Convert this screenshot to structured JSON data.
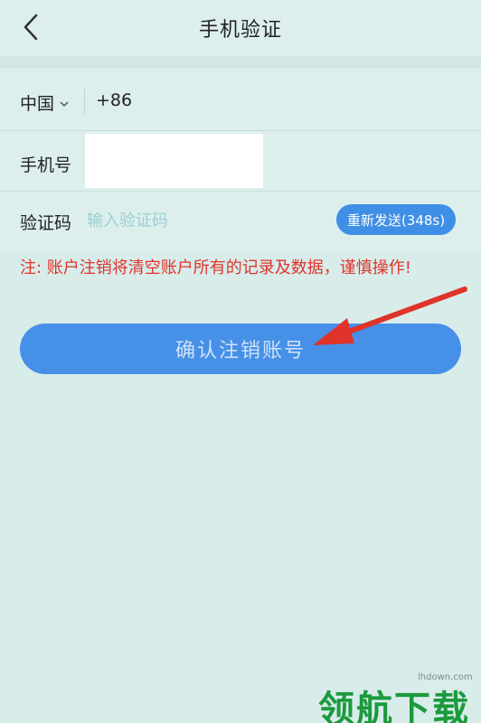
{
  "header": {
    "title": "手机验证",
    "back_icon": "chevron-left-icon"
  },
  "form": {
    "country": {
      "label": "中国",
      "code": "+86",
      "icon": "chevron-down-icon"
    },
    "phone": {
      "label": "手机号",
      "value": ""
    },
    "verification": {
      "label": "验证码",
      "placeholder": "输入验证码",
      "resend_label": "重新发送(348s)"
    }
  },
  "notice": "注: 账户注销将清空账户所有的记录及数据，谨慎操作!",
  "confirm_button": "确认注销账号",
  "watermark": {
    "domain": "lhdown.com",
    "text": "领航下载"
  },
  "colors": {
    "accent": "#4690e8",
    "warning": "#e0342b",
    "background": "#d8ecea",
    "annotation_arrow": "#e0332a"
  }
}
